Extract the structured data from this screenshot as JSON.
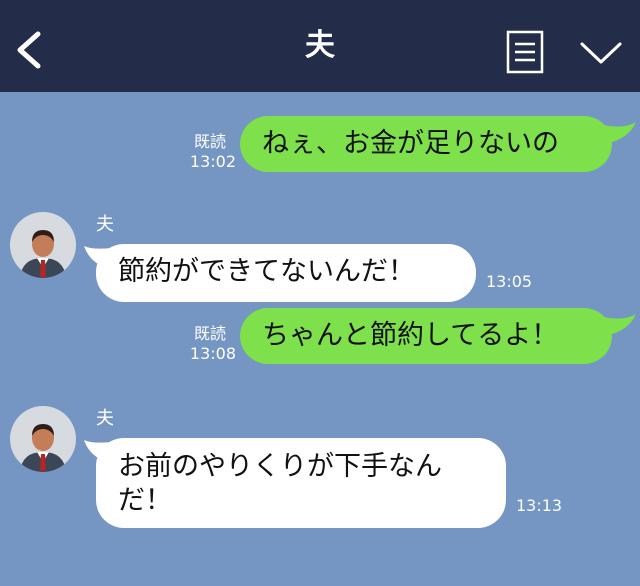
{
  "header": {
    "title": "夫"
  },
  "messages": [
    {
      "read": "既読",
      "time": "13:02",
      "text": "ねぇ、お金が足りないの"
    },
    {
      "sender": "夫",
      "time": "13:05",
      "text": "節約ができてないんだ！"
    },
    {
      "read": "既読",
      "time": "13:08",
      "text": "ちゃんと節約してるよ！"
    },
    {
      "sender": "夫",
      "time": "13:13",
      "text": "お前のやりくりが下手なんだ！"
    }
  ],
  "colors": {
    "header": "#232d4a",
    "background": "#7595c3",
    "bubble_out": "#7ee04a",
    "bubble_in": "#ffffff"
  },
  "icons": [
    "chevron-left-icon",
    "menu-list-icon",
    "chevron-down-icon",
    "avatar-icon"
  ]
}
